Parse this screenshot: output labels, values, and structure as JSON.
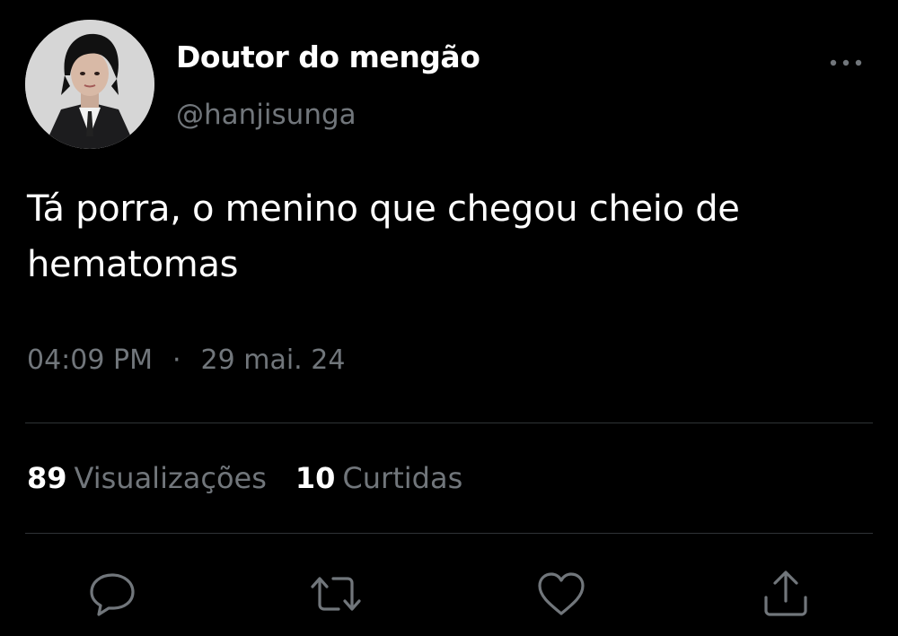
{
  "user": {
    "display_name": "Doutor do mengão",
    "handle": "@hanjisunga",
    "avatar": "avatar"
  },
  "tweet": {
    "text": "Tá porra, o menino que chegou cheio de hematomas",
    "time": "04:09 PM",
    "separator": "·",
    "date": "29 mai. 24"
  },
  "stats": {
    "views_count": "89",
    "views_label": "Visualizações",
    "likes_count": "10",
    "likes_label": "Curtidas"
  },
  "actions": {
    "reply": "reply-icon",
    "retweet": "retweet-icon",
    "like": "heart-icon",
    "share": "share-icon"
  },
  "colors": {
    "background": "#000000",
    "text": "#ffffff",
    "secondary": "#71767b",
    "divider": "#2f3336"
  }
}
